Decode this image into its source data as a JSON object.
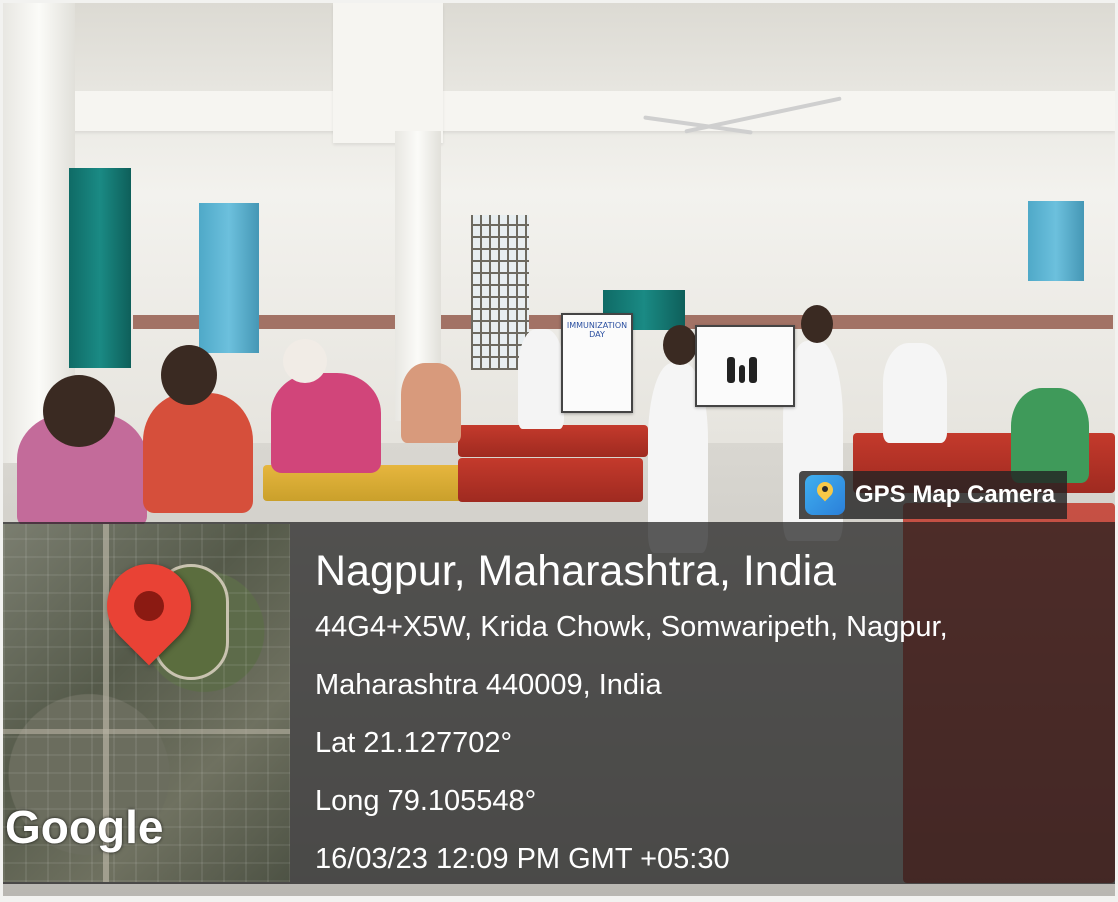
{
  "badge": {
    "app_name": "GPS Map Camera",
    "icon": "map-pin-app-icon"
  },
  "map": {
    "brand": "Google",
    "pin_icon": "location-pin-icon",
    "pin_color": "#e94235"
  },
  "location": {
    "title": "Nagpur, Maharashtra, India",
    "address_line1": "44G4+X5W, Krida Chowk, Somwaripeth, Nagpur,",
    "address_line2": "Maharashtra 440009, India",
    "latitude": "Lat 21.127702°",
    "longitude": "Long 79.105548°",
    "timestamp": "16/03/23 12:09 PM GMT +05:30"
  },
  "posters": {
    "left_title": "IMMUNIZATION DAY"
  }
}
